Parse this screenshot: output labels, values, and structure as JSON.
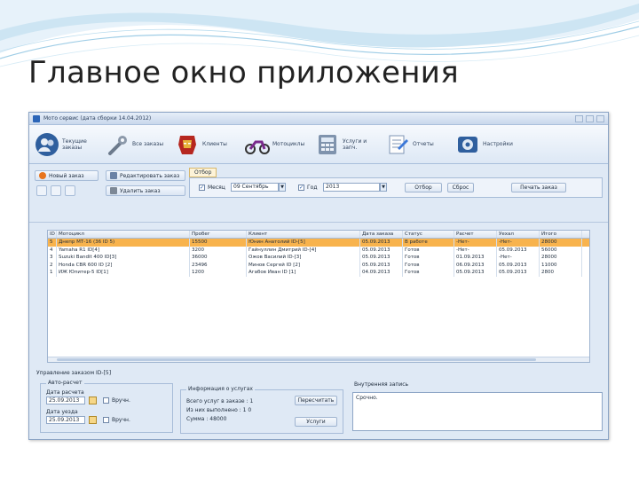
{
  "slide": {
    "title": "Главное окно приложения"
  },
  "window": {
    "title": "Мото сервис (дата сборки 14.04.2012)"
  },
  "ribbon": [
    {
      "icon": "user-group-icon",
      "label": "Текущие заказы"
    },
    {
      "icon": "wrench-icon",
      "label": "Все заказы"
    },
    {
      "icon": "ironman-mask-icon",
      "label": "Клиенты"
    },
    {
      "icon": "motorcycle-icon",
      "label": "Мотоциклы"
    },
    {
      "icon": "calculator-icon",
      "label": "Услуги и запч."
    },
    {
      "icon": "report-icon",
      "label": "Отчеты"
    },
    {
      "icon": "settings-icon",
      "label": "Настройки"
    }
  ],
  "toolbar": {
    "new_order": "Новый заказ",
    "edit_order": "Редактировать заказ",
    "delete_order": "Удалить заказ"
  },
  "filter": {
    "tab": "Отбор",
    "month_label": "Месяц",
    "month_value": "09 Сентябрь",
    "year_label": "Год",
    "year_value": "2013",
    "apply": "Отбор",
    "reset": "Сброс",
    "right_button": "Печать заказ"
  },
  "grid": {
    "columns": [
      "ID",
      "Мотоцикл",
      "Пробег",
      "Клиент",
      "Дата заказа",
      "Статус",
      "Расчет",
      "Уехал",
      "Итого"
    ],
    "rows": [
      {
        "id": "5",
        "moto": "Днепр МТ-16 (36 ID 5)",
        "run": "15500",
        "client": "Юнин Анатолий ID-[5]",
        "date": "05.09.2013",
        "status": "В работе",
        "calc": "-Нет-",
        "left": "-Нет-",
        "total": "28000"
      },
      {
        "id": "4",
        "moto": "Yamaha R1 ID[4]",
        "run": "3200",
        "client": "Гайнуллин Дмитрий ID-[4]",
        "date": "05.09.2013",
        "status": "Готов",
        "calc": "-Нет-",
        "left": "05.09.2013",
        "total": "56000"
      },
      {
        "id": "3",
        "moto": "Suzuki Bandit 400 ID[3]",
        "run": "36000",
        "client": "Ожов Василий ID-[3]",
        "date": "05.09.2013",
        "status": "Готов",
        "calc": "01.09.2013",
        "left": "-Нет-",
        "total": "28000"
      },
      {
        "id": "2",
        "moto": "Honda CBR 600 ID [2]",
        "run": "23496",
        "client": "Минов Сергей ID [2]",
        "date": "05.09.2013",
        "status": "Готов",
        "calc": "06.09.2013",
        "left": "05.09.2013",
        "total": "11000"
      },
      {
        "id": "1",
        "moto": "ИЖ Юпитер-5 ID[1]",
        "run": "1200",
        "client": "Агабов Иван ID [1]",
        "date": "04.09.2013",
        "status": "Готов",
        "calc": "05.09.2013",
        "left": "05.09.2013",
        "total": "2800"
      }
    ]
  },
  "bottom": {
    "title": "Управление заказом ID-[5]",
    "auto_dates": "Авто-расчет",
    "calc_date_label": "Дата расчета",
    "calc_date_value": "25.09.2013",
    "calc_manual": "Вручн.",
    "left_date_label": "Дата уезда",
    "left_date_value": "25.09.2013",
    "left_manual": "Вручн.",
    "info_title": "Информация о услугах",
    "info_total": "Всего услуг в заказе : 1",
    "info_done": "Из них выполнено : 1 0",
    "info_sum": "Сумма : 48000",
    "recalc_button": "Пересчитать",
    "services_button": "Услуги",
    "note_label": "Внутренняя запись",
    "note_text": "Срочно."
  },
  "colors": {
    "accent": "#2c66b8",
    "selected_row": "#f8b34d",
    "window_bg": "#dfe9f5"
  }
}
